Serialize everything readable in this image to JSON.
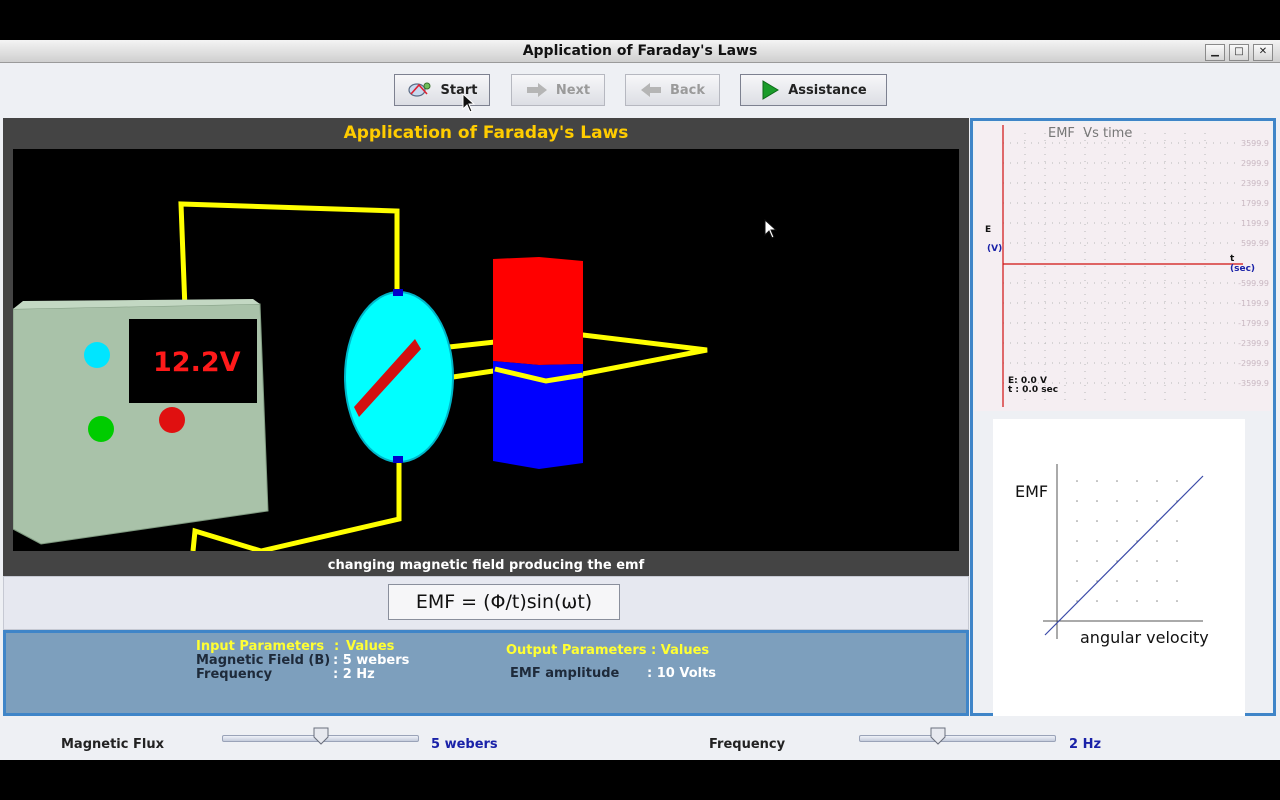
{
  "window": {
    "title": "Application of Faraday's Laws"
  },
  "toolbar": {
    "start": "Start",
    "next": "Next",
    "back": "Back",
    "assistance": "Assistance"
  },
  "simulation": {
    "heading": "Application of Faraday's Laws",
    "meter_reading": "12.2V",
    "caption": "changing magnetic field producing the emf"
  },
  "formula": "EMF = (Φ/t)sin(ωt)",
  "input_params": {
    "header_left": "Input Parameters",
    "header_sep": ":",
    "header_right": "Values",
    "rows": [
      {
        "name": "Magnetic Field (B)",
        "value": ": 5 webers"
      },
      {
        "name": "Frequency",
        "value": ": 2 Hz"
      }
    ]
  },
  "output_params": {
    "header": "Output Parameters : Values",
    "rows": [
      {
        "name": "EMF amplitude",
        "value": ": 10 Volts"
      }
    ]
  },
  "graph_top": {
    "title": "EMF  Vs time",
    "y_label": "E",
    "y_unit": "(V)",
    "x_label": "t",
    "x_unit": "(sec)",
    "readout_e": "E: 0.0 V",
    "readout_t": "t : 0.0 sec",
    "y_ticks": [
      "3599.9",
      "2999.9",
      "2399.9",
      "1799.9",
      "1199.9",
      "599.99",
      "-599.99",
      "-1199.9",
      "-1799.9",
      "-2399.9",
      "-2999.9",
      "-3599.9"
    ]
  },
  "graph_bottom": {
    "y_label": "EMF",
    "x_label": "angular velocity"
  },
  "sliders": {
    "flux": {
      "label": "Magnetic Flux",
      "value_text": "5 webers",
      "position": 0.5
    },
    "frequency": {
      "label": "Frequency",
      "value_text": "2 Hz",
      "position": 0.4
    }
  },
  "colors": {
    "heading": "#ffcc00",
    "wire": "#ffff00",
    "magnet_north": "#ff0000",
    "magnet_south": "#0000ff",
    "coil": "#00ffff",
    "panel_border": "#3f85c8"
  }
}
